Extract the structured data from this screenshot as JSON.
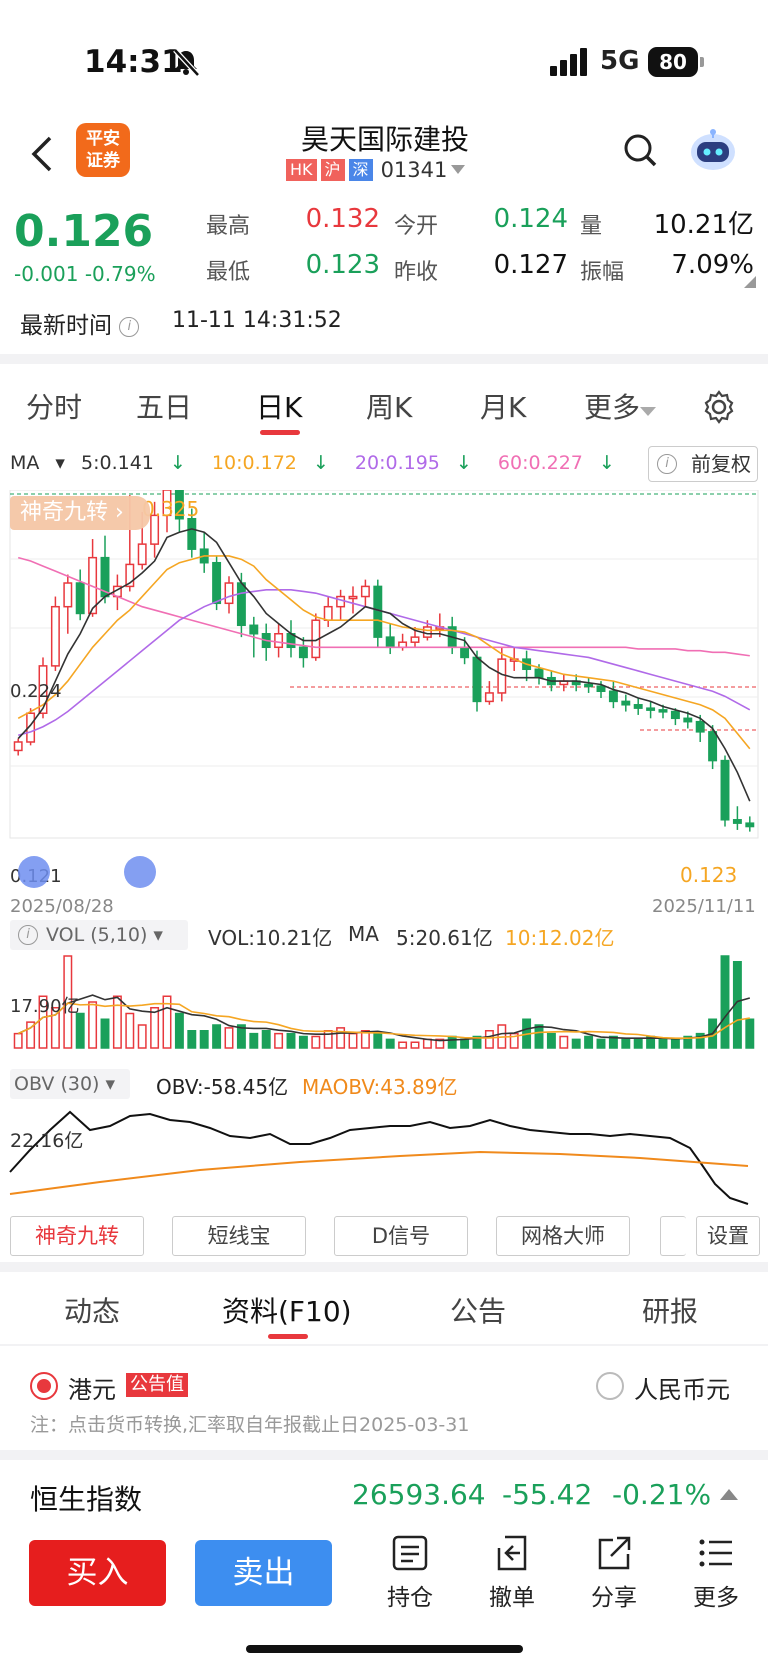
{
  "status": {
    "time": "14:31",
    "network": "5G",
    "battery": "80"
  },
  "header": {
    "logo_line1": "平安",
    "logo_line2": "证券",
    "stock_name": "昊天国际建投",
    "tag_hk": "HK",
    "tag_sh": "沪",
    "tag_sz": "深",
    "code": "01341"
  },
  "quote": {
    "price": "0.126",
    "change": "-0.001",
    "change_pct": "-0.79%",
    "high_label": "最高",
    "high": "0.132",
    "open_label": "今开",
    "open": "0.124",
    "vol_label": "量",
    "vol": "10.21亿",
    "low_label": "最低",
    "low": "0.123",
    "prev_label": "昨收",
    "prev": "0.127",
    "amp_label": "振幅",
    "amp": "7.09%",
    "latest_label": "最新时间",
    "latest_time": "11-11 14:31:52"
  },
  "ktabs": [
    "分时",
    "五日",
    "日K",
    "周K",
    "月K",
    "更多"
  ],
  "ma": {
    "label": "MA",
    "ma5": "5:0.141",
    "ma10": "10:0.172",
    "ma20": "20:0.195",
    "ma60": "60:0.227",
    "adjust": "前复权"
  },
  "colors": {
    "up": "#e8383d",
    "down": "#1aa05a",
    "ma5": "#333333",
    "ma10": "#f5a623",
    "ma20": "#b06ae8",
    "ma60": "#f06fb4"
  },
  "chart_data": {
    "type": "candlestick",
    "dates": [
      "2025/08/28",
      "2025/11/11"
    ],
    "ylim": [
      0.121,
      0.325
    ],
    "price_labels": {
      "high": "0.325",
      "mid": "0.224",
      "low": "0.121",
      "last_low": "0.123"
    },
    "candles": [
      [
        0.171,
        0.176,
        0.168,
        0.178
      ],
      [
        0.176,
        0.193,
        0.174,
        0.196
      ],
      [
        0.193,
        0.221,
        0.19,
        0.226
      ],
      [
        0.221,
        0.256,
        0.218,
        0.262
      ],
      [
        0.256,
        0.27,
        0.24,
        0.275
      ],
      [
        0.27,
        0.252,
        0.248,
        0.278
      ],
      [
        0.252,
        0.285,
        0.25,
        0.296
      ],
      [
        0.285,
        0.262,
        0.258,
        0.298
      ],
      [
        0.262,
        0.268,
        0.254,
        0.275
      ],
      [
        0.268,
        0.281,
        0.265,
        0.322
      ],
      [
        0.281,
        0.293,
        0.278,
        0.312
      ],
      [
        0.293,
        0.31,
        0.285,
        0.318
      ],
      [
        0.31,
        0.325,
        0.3,
        0.325
      ],
      [
        0.325,
        0.308,
        0.3,
        0.328
      ],
      [
        0.308,
        0.29,
        0.285,
        0.314
      ],
      [
        0.29,
        0.282,
        0.276,
        0.3
      ],
      [
        0.282,
        0.258,
        0.254,
        0.286
      ],
      [
        0.258,
        0.27,
        0.252,
        0.274
      ],
      [
        0.27,
        0.245,
        0.238,
        0.276
      ],
      [
        0.245,
        0.24,
        0.226,
        0.25
      ],
      [
        0.24,
        0.232,
        0.224,
        0.246
      ],
      [
        0.232,
        0.24,
        0.226,
        0.246
      ],
      [
        0.24,
        0.232,
        0.226,
        0.248
      ],
      [
        0.232,
        0.226,
        0.22,
        0.238
      ],
      [
        0.226,
        0.248,
        0.224,
        0.252
      ],
      [
        0.248,
        0.256,
        0.244,
        0.262
      ],
      [
        0.256,
        0.262,
        0.248,
        0.266
      ],
      [
        0.262,
        0.262,
        0.252,
        0.268
      ],
      [
        0.262,
        0.268,
        0.256,
        0.272
      ],
      [
        0.268,
        0.238,
        0.232,
        0.272
      ],
      [
        0.238,
        0.232,
        0.228,
        0.246
      ],
      [
        0.232,
        0.235,
        0.23,
        0.24
      ],
      [
        0.235,
        0.238,
        0.232,
        0.244
      ],
      [
        0.238,
        0.244,
        0.236,
        0.248
      ],
      [
        0.244,
        0.244,
        0.238,
        0.252
      ],
      [
        0.244,
        0.232,
        0.228,
        0.25
      ],
      [
        0.232,
        0.226,
        0.222,
        0.238
      ],
      [
        0.226,
        0.2,
        0.194,
        0.23
      ],
      [
        0.2,
        0.205,
        0.198,
        0.212
      ],
      [
        0.205,
        0.225,
        0.2,
        0.232
      ],
      [
        0.225,
        0.225,
        0.218,
        0.232
      ],
      [
        0.225,
        0.219,
        0.212,
        0.23
      ],
      [
        0.219,
        0.214,
        0.21,
        0.222
      ],
      [
        0.214,
        0.21,
        0.206,
        0.218
      ],
      [
        0.21,
        0.212,
        0.206,
        0.216
      ],
      [
        0.212,
        0.21,
        0.206,
        0.216
      ],
      [
        0.21,
        0.209,
        0.205,
        0.214
      ],
      [
        0.209,
        0.206,
        0.202,
        0.212
      ],
      [
        0.206,
        0.2,
        0.196,
        0.212
      ],
      [
        0.2,
        0.198,
        0.194,
        0.204
      ],
      [
        0.198,
        0.196,
        0.192,
        0.202
      ],
      [
        0.196,
        0.195,
        0.19,
        0.2
      ],
      [
        0.195,
        0.194,
        0.19,
        0.198
      ],
      [
        0.194,
        0.19,
        0.186,
        0.196
      ],
      [
        0.19,
        0.188,
        0.184,
        0.194
      ],
      [
        0.188,
        0.182,
        0.176,
        0.192
      ],
      [
        0.182,
        0.165,
        0.16,
        0.186
      ],
      [
        0.165,
        0.13,
        0.126,
        0.168
      ],
      [
        0.13,
        0.128,
        0.124,
        0.138
      ],
      [
        0.128,
        0.126,
        0.123,
        0.132
      ]
    ],
    "ma5": [
      0.178,
      0.186,
      0.196,
      0.212,
      0.228,
      0.24,
      0.255,
      0.262,
      0.266,
      0.27,
      0.276,
      0.283,
      0.297,
      0.3,
      0.302,
      0.3,
      0.294,
      0.282,
      0.27,
      0.262,
      0.252,
      0.246,
      0.24,
      0.236,
      0.236,
      0.24,
      0.244,
      0.25,
      0.256,
      0.254,
      0.252,
      0.246,
      0.242,
      0.24,
      0.24,
      0.238,
      0.236,
      0.226,
      0.22,
      0.216,
      0.214,
      0.214,
      0.214,
      0.212,
      0.212,
      0.212,
      0.211,
      0.21,
      0.207,
      0.205,
      0.202,
      0.2,
      0.197,
      0.195,
      0.193,
      0.19,
      0.184,
      0.172,
      0.158,
      0.141
    ],
    "ma10": [
      0.19,
      0.194,
      0.198,
      0.204,
      0.212,
      0.222,
      0.232,
      0.24,
      0.248,
      0.254,
      0.262,
      0.27,
      0.278,
      0.282,
      0.284,
      0.286,
      0.286,
      0.286,
      0.284,
      0.28,
      0.272,
      0.266,
      0.26,
      0.254,
      0.25,
      0.248,
      0.248,
      0.248,
      0.248,
      0.248,
      0.246,
      0.244,
      0.243,
      0.242,
      0.242,
      0.242,
      0.241,
      0.238,
      0.233,
      0.228,
      0.225,
      0.222,
      0.22,
      0.218,
      0.216,
      0.215,
      0.214,
      0.213,
      0.212,
      0.21,
      0.208,
      0.206,
      0.204,
      0.202,
      0.2,
      0.198,
      0.195,
      0.19,
      0.181,
      0.172
    ],
    "ma20": [
      0.18,
      0.182,
      0.185,
      0.189,
      0.194,
      0.2,
      0.206,
      0.212,
      0.218,
      0.224,
      0.23,
      0.236,
      0.242,
      0.248,
      0.252,
      0.256,
      0.259,
      0.262,
      0.264,
      0.265,
      0.266,
      0.266,
      0.266,
      0.265,
      0.264,
      0.262,
      0.26,
      0.258,
      0.256,
      0.254,
      0.252,
      0.25,
      0.248,
      0.246,
      0.244,
      0.242,
      0.24,
      0.238,
      0.236,
      0.234,
      0.232,
      0.231,
      0.23,
      0.229,
      0.228,
      0.227,
      0.226,
      0.224,
      0.222,
      0.22,
      0.218,
      0.216,
      0.214,
      0.212,
      0.21,
      0.208,
      0.206,
      0.203,
      0.199,
      0.195
    ],
    "ma60": [
      0.285,
      0.283,
      0.28,
      0.277,
      0.274,
      0.271,
      0.268,
      0.265,
      0.262,
      0.259,
      0.256,
      0.254,
      0.252,
      0.25,
      0.248,
      0.246,
      0.244,
      0.242,
      0.24,
      0.238,
      0.236,
      0.235,
      0.234,
      0.233,
      0.232,
      0.232,
      0.232,
      0.232,
      0.232,
      0.232,
      0.232,
      0.232,
      0.232,
      0.232,
      0.232,
      0.232,
      0.232,
      0.232,
      0.232,
      0.232,
      0.232,
      0.232,
      0.232,
      0.232,
      0.232,
      0.232,
      0.232,
      0.232,
      0.232,
      0.232,
      0.231,
      0.231,
      0.231,
      0.231,
      0.23,
      0.23,
      0.229,
      0.229,
      0.228,
      0.227
    ],
    "volume": {
      "label": "VOL (5,10)",
      "vol": "VOL:10.21亿",
      "ma_label": "MA",
      "ma5": "5:20.61亿",
      "ma10": "10:12.02亿",
      "axis_label": "17.90亿",
      "values": [
        5,
        9,
        18,
        14,
        32,
        12,
        16,
        10,
        18,
        12,
        8,
        14,
        18,
        12,
        6,
        6,
        8,
        7,
        8,
        5,
        6,
        5,
        5,
        4,
        4,
        6,
        7,
        5,
        6,
        5,
        3,
        2,
        2,
        3,
        3,
        4,
        3,
        4,
        6,
        8,
        5,
        10,
        8,
        5,
        4,
        3,
        4,
        3,
        4,
        3,
        3,
        4,
        3,
        3,
        4,
        5,
        10,
        32,
        30,
        10
      ]
    },
    "obv": {
      "label": "OBV (30)",
      "obv": "OBV:-58.45亿",
      "maobv": "MAOBV:43.89亿",
      "axis_label": "22.16亿"
    }
  },
  "magic": "神奇九转",
  "tools": [
    "神奇九转",
    "短线宝",
    "D信号",
    "网格大师",
    "设置"
  ],
  "f10tabs": [
    "动态",
    "资料(F10)",
    "公告",
    "研报"
  ],
  "currency": {
    "hkd": "港元",
    "badge": "公告值",
    "rmb": "人民币元",
    "note": "注：点击货币转换,汇率取自年报截止日2025-03-31"
  },
  "hsi": {
    "name": "恒生指数",
    "value": "26593.64",
    "change": "-55.42",
    "pct": "-0.21%"
  },
  "bottom": {
    "buy": "买入",
    "sell": "卖出",
    "hold": "持仓",
    "cancel": "撤单",
    "share": "分享",
    "more": "更多"
  }
}
